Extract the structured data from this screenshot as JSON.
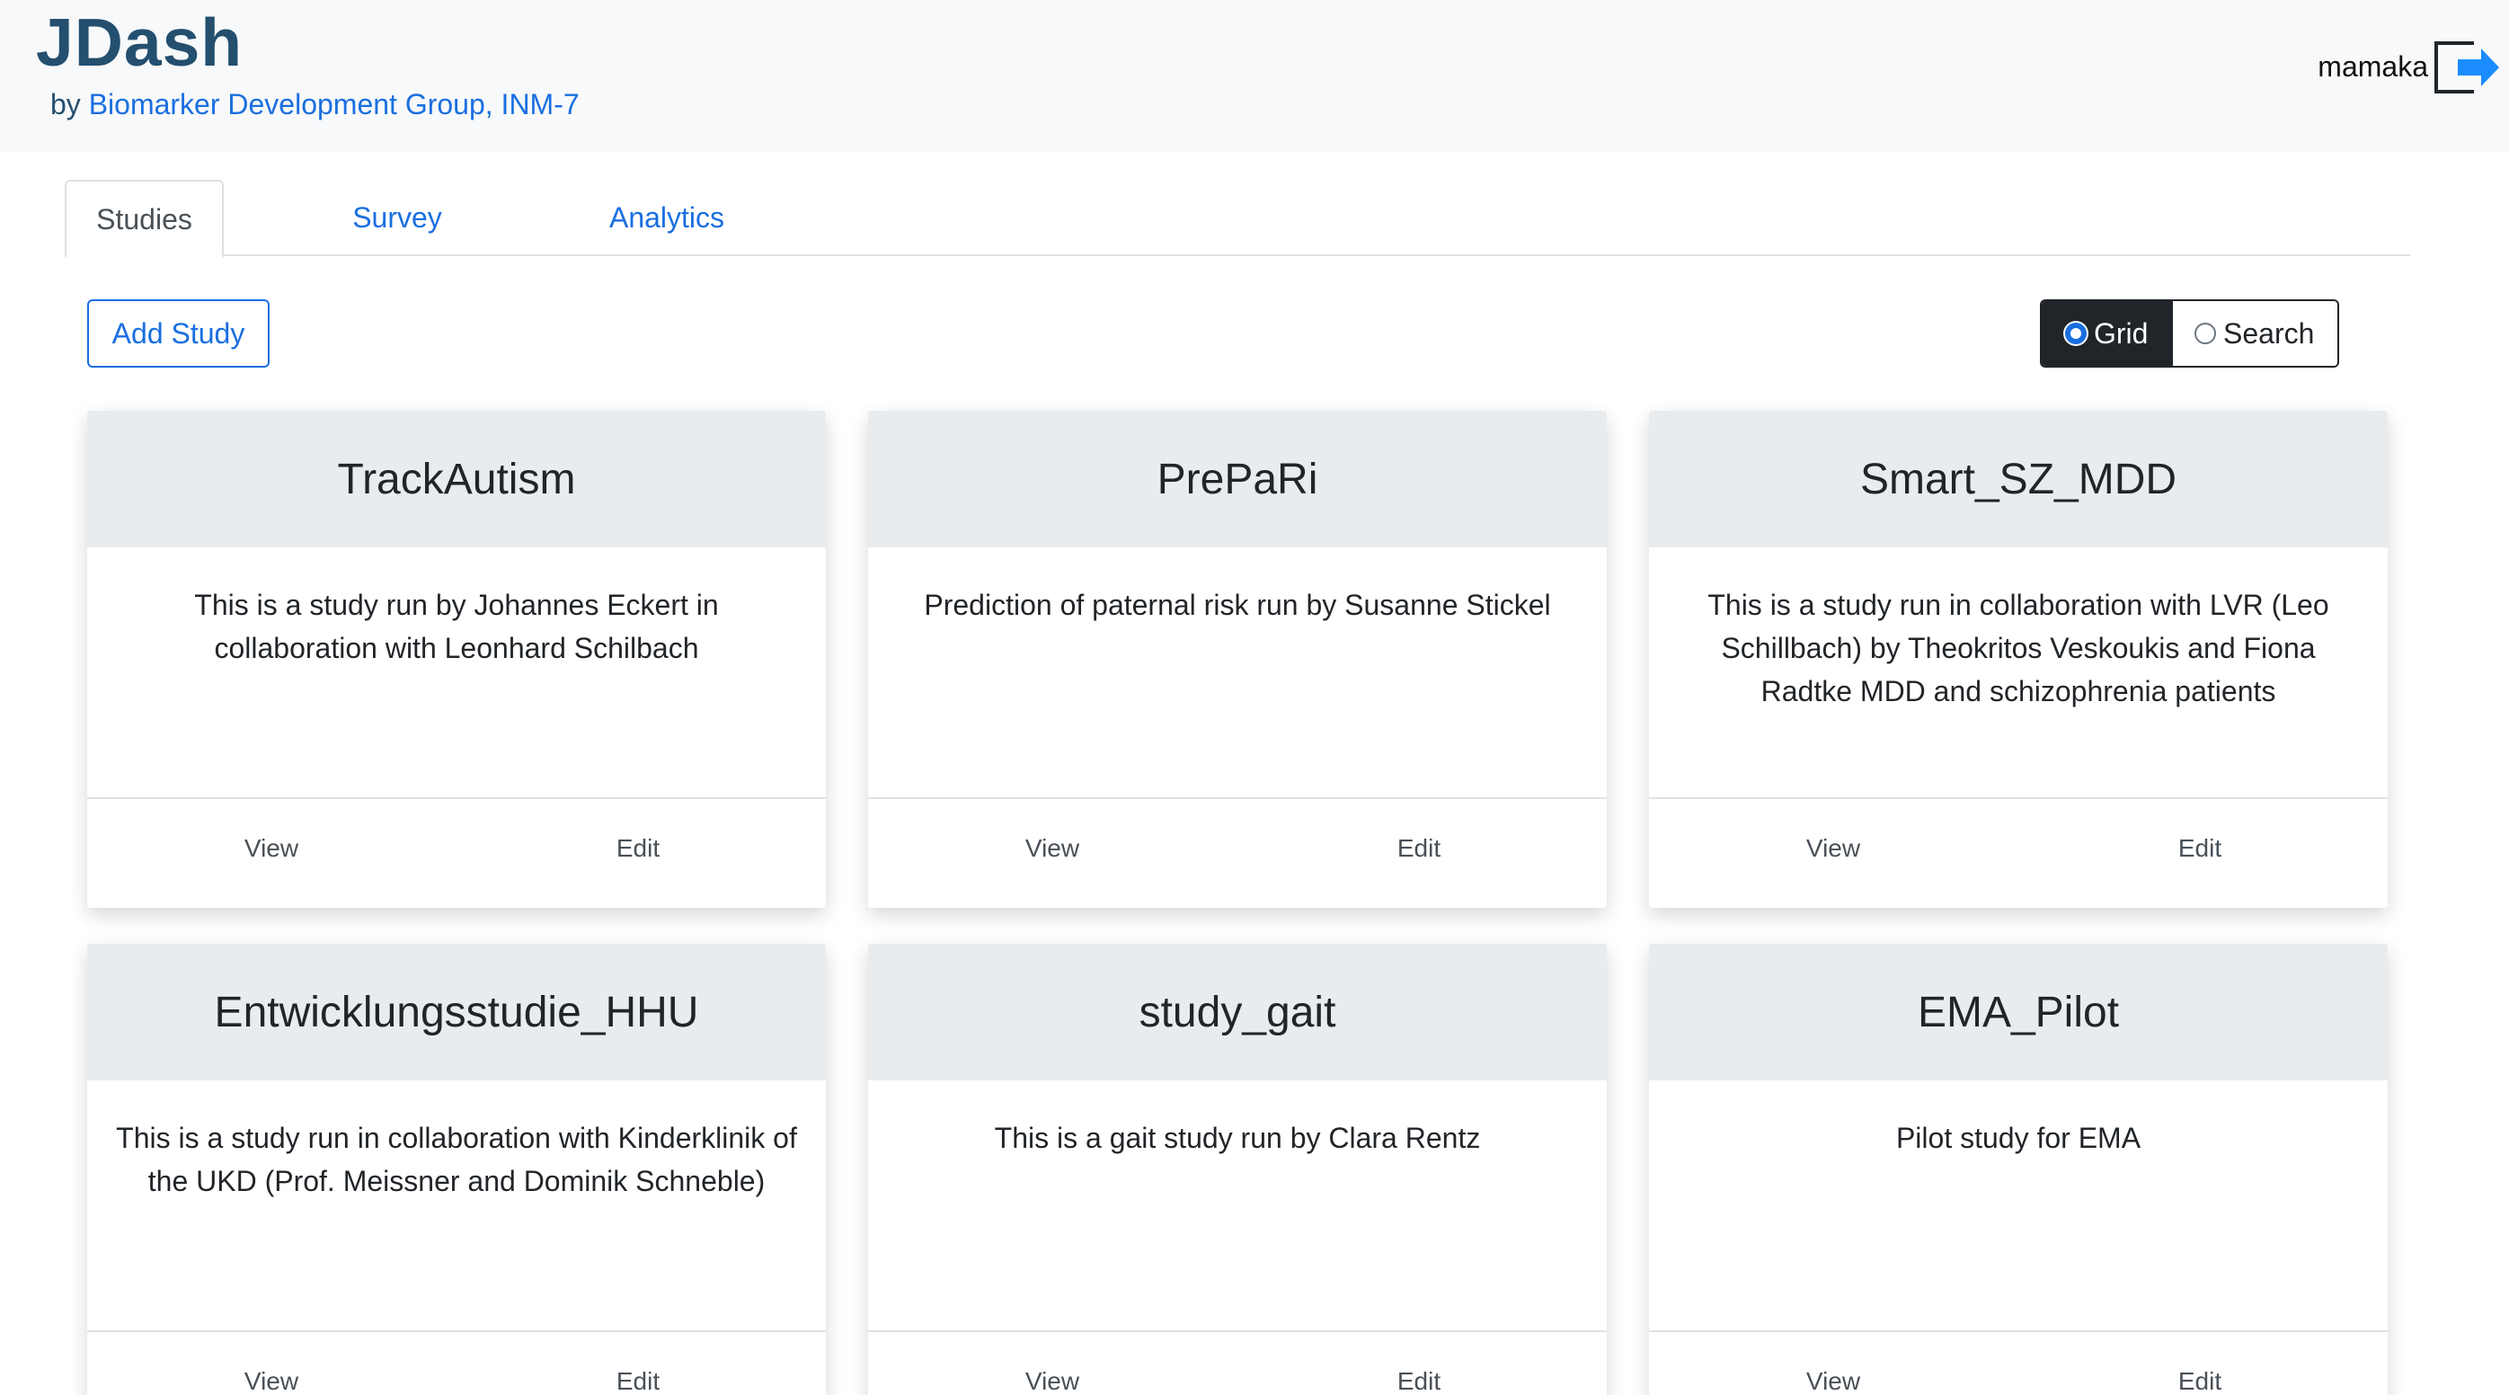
{
  "header": {
    "brand": "JDash",
    "by_prefix": "by",
    "by_link": "Biomarker Development Group, INM-7",
    "username": "mamaka",
    "logout_icon": "logout-arrow-icon"
  },
  "tabs": [
    {
      "label": "Studies",
      "active": true
    },
    {
      "label": "Survey",
      "active": false
    },
    {
      "label": "Analytics",
      "active": false
    }
  ],
  "toolbar": {
    "add_label": "Add Study",
    "view_options": [
      {
        "label": "Grid",
        "selected": true
      },
      {
        "label": "Search",
        "selected": false
      }
    ]
  },
  "studies": [
    {
      "title": "TrackAutism",
      "description": "This is a study run by Johannes Eckert in collaboration with Leonhard Schilbach",
      "view_label": "View",
      "edit_label": "Edit"
    },
    {
      "title": "PrePaRi",
      "description": "Prediction of paternal risk run by Susanne Stickel",
      "view_label": "View",
      "edit_label": "Edit"
    },
    {
      "title": "Smart_SZ_MDD",
      "description": "This is a study run in collaboration with LVR (Leo Schillbach) by Theokritos Veskoukis and Fiona Radtke MDD and schizophrenia patients",
      "view_label": "View",
      "edit_label": "Edit"
    },
    {
      "title": "Entwicklungsstudie_HHU",
      "description": "This is a study run in collaboration with Kinderklinik of the UKD (Prof. Meissner and Dominik Schneble)",
      "view_label": "View",
      "edit_label": "Edit"
    },
    {
      "title": "study_gait",
      "description": "This is a gait study run by Clara Rentz",
      "view_label": "View",
      "edit_label": "Edit"
    },
    {
      "title": "EMA_Pilot",
      "description": "Pilot study for EMA",
      "view_label": "View",
      "edit_label": "Edit"
    }
  ],
  "colors": {
    "brand": "#244f6f",
    "link": "#1a6fe0",
    "header_bg": "#f8f9fa",
    "card_head_bg": "#e9ecef"
  }
}
